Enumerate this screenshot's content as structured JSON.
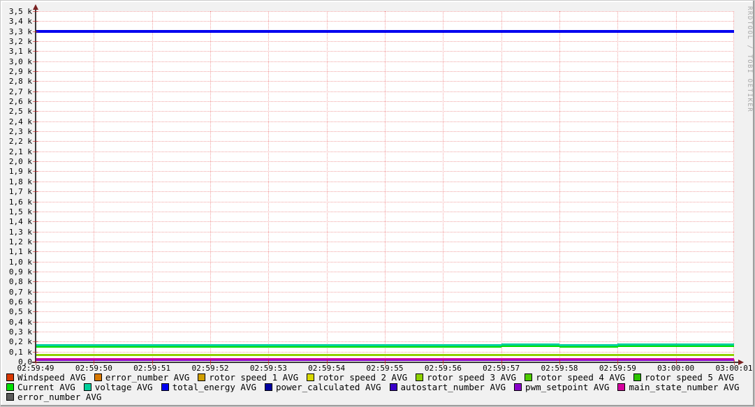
{
  "watermark": "RRDTOOL / TOBI OETIKER",
  "colors": {
    "outer_background": "#f1f1f1",
    "plot_background": "#ffffff",
    "grid_major": "#f2a2a2",
    "axis": "#3a3a3a",
    "axis_arrow": "#7a2222",
    "watermark": "#a6a6a6"
  },
  "chart_data": {
    "type": "line",
    "title": "",
    "xlabel": "",
    "ylabel": "",
    "ylim": [
      0,
      3500
    ],
    "y_unit_note": "axis labeled in k with comma decimal separator",
    "grid": true,
    "legend_position": "bottom",
    "x": [
      "02:59:49",
      "02:59:50",
      "02:59:51",
      "02:59:52",
      "02:59:53",
      "02:59:54",
      "02:59:55",
      "02:59:56",
      "02:59:57",
      "02:59:58",
      "02:59:59",
      "03:00:00",
      "03:00:01"
    ],
    "y_tick_labels": [
      "3,5 k",
      "3,4 k",
      "3,3 k",
      "3,2 k",
      "3,1 k",
      "3,0 k",
      "2,9 k",
      "2,8 k",
      "2,7 k",
      "2,6 k",
      "2,5 k",
      "2,4 k",
      "2,3 k",
      "2,2 k",
      "2,1 k",
      "2,0 k",
      "1,9 k",
      "1,8 k",
      "1,7 k",
      "1,6 k",
      "1,5 k",
      "1,4 k",
      "1,3 k",
      "1,2 k",
      "1,1 k",
      "1,0 k",
      "0,9 k",
      "0,8 k",
      "0,7 k",
      "0,6 k",
      "0,5 k",
      "0,4 k",
      "0,3 k",
      "0,2 k",
      "0,1 k",
      "0,0"
    ],
    "series": [
      {
        "name": "Windspeed AVG",
        "color": "#d83800",
        "width": 1,
        "values": [
          0,
          0,
          0,
          0,
          0,
          0,
          0,
          0,
          0,
          0,
          0,
          0,
          0
        ]
      },
      {
        "name": "error_number AVG",
        "color": "#d87800",
        "width": 1,
        "values": [
          0,
          0,
          0,
          0,
          0,
          0,
          0,
          0,
          0,
          0,
          0,
          0,
          0
        ]
      },
      {
        "name": "rotor speed 1 AVG",
        "color": "#cf9e00",
        "width": 1,
        "values": [
          0,
          0,
          0,
          0,
          0,
          0,
          0,
          0,
          0,
          0,
          0,
          0,
          0
        ]
      },
      {
        "name": "rotor speed 2 AVG",
        "color": "#d8d800",
        "width": 1,
        "values": [
          0,
          0,
          0,
          0,
          0,
          0,
          0,
          0,
          0,
          0,
          0,
          0,
          0
        ]
      },
      {
        "name": "rotor speed 3 AVG",
        "color": "#8ed200",
        "width": 3,
        "values": [
          65,
          65,
          65,
          65,
          65,
          65,
          65,
          65,
          65,
          65,
          65,
          65,
          65
        ]
      },
      {
        "name": "rotor speed 4 AVG",
        "color": "#4ecb00",
        "width": 1,
        "values": [
          0,
          0,
          0,
          0,
          0,
          0,
          0,
          0,
          0,
          0,
          0,
          0,
          0
        ]
      },
      {
        "name": "rotor speed 5 AVG",
        "color": "#2cc400",
        "width": 1,
        "values": [
          0,
          0,
          0,
          0,
          0,
          0,
          0,
          0,
          0,
          0,
          0,
          0,
          0
        ]
      },
      {
        "name": "Current AVG",
        "color": "#00e000",
        "width": 3,
        "values": [
          150,
          150,
          150,
          150,
          150,
          150,
          150,
          150,
          158,
          151,
          158,
          158,
          158
        ]
      },
      {
        "name": "voltage AVG",
        "color": "#00cf9b",
        "width": 3,
        "values": [
          165,
          165,
          165,
          165,
          165,
          165,
          165,
          165,
          173,
          166,
          173,
          173,
          173
        ]
      },
      {
        "name": "total_energy AVG",
        "color": "#0000f0",
        "width": 4,
        "values": [
          3295,
          3295,
          3295,
          3295,
          3295,
          3295,
          3295,
          3295,
          3295,
          3295,
          3295,
          3295,
          3295
        ]
      },
      {
        "name": "power_calculated AVG",
        "color": "#0000a0",
        "width": 1,
        "values": [
          0,
          0,
          0,
          0,
          0,
          0,
          0,
          0,
          0,
          0,
          0,
          0,
          0
        ]
      },
      {
        "name": "autostart_number AVG",
        "color": "#3a00c8",
        "width": 1,
        "values": [
          0,
          0,
          0,
          0,
          0,
          0,
          0,
          0,
          0,
          0,
          0,
          0,
          0
        ]
      },
      {
        "name": "pwm_setpoint AVG",
        "color": "#8800c8",
        "width": 2,
        "values": [
          14,
          14,
          14,
          14,
          14,
          14,
          14,
          14,
          14,
          14,
          14,
          14,
          14
        ]
      },
      {
        "name": "main_state_number AVG",
        "color": "#d4009e",
        "width": 2,
        "values": [
          28,
          28,
          28,
          28,
          28,
          28,
          28,
          28,
          28,
          28,
          28,
          28,
          28
        ]
      },
      {
        "name": "error_number AVG",
        "color": "#5a5a5a",
        "width": 1,
        "values": [
          0,
          0,
          0,
          0,
          0,
          0,
          0,
          0,
          0,
          0,
          0,
          0,
          0
        ]
      }
    ],
    "legend_rows": [
      [
        0,
        1,
        2,
        3,
        4,
        5,
        6
      ],
      [
        7,
        8,
        9,
        10,
        11,
        12,
        13
      ],
      [
        14
      ]
    ]
  }
}
